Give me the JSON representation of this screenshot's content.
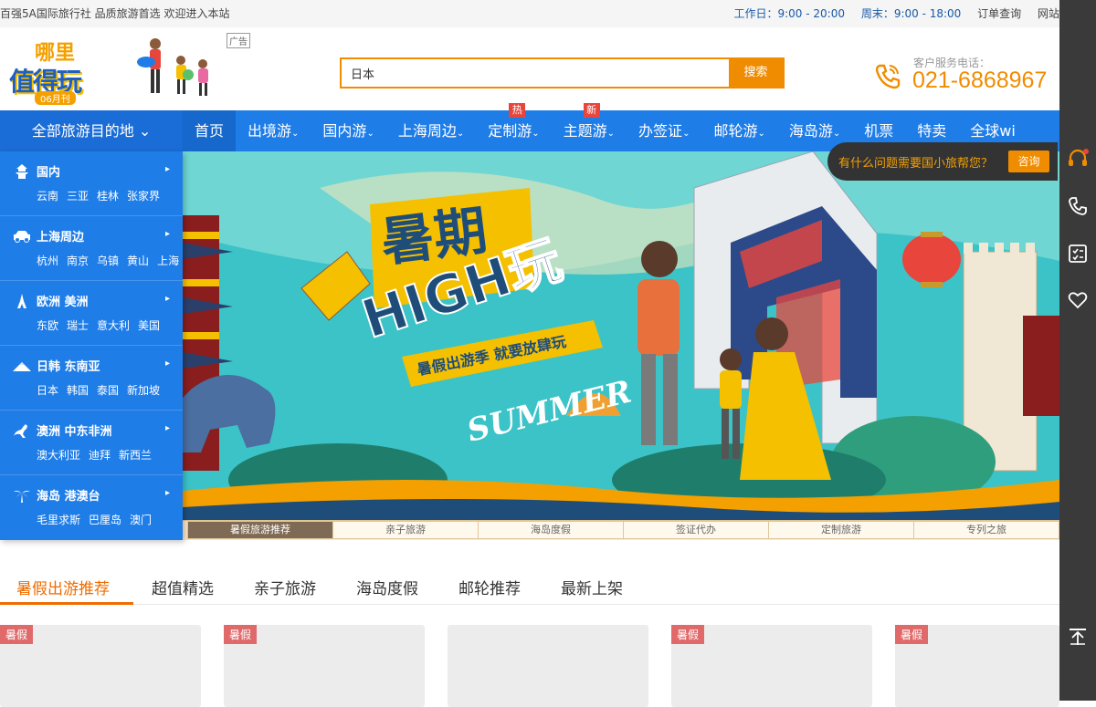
{
  "topbar": {
    "left_text": "百强5A国际旅行社 品质旅游首选   欢迎进入本站",
    "workday": "工作日：9:00 - 20:00",
    "weekend": "周末：9:00 - 18:00",
    "order": "订单查询",
    "site": "网站"
  },
  "header": {
    "logo_line1": "哪里",
    "logo_line2": "值得玩",
    "logo_badge": "06月刊",
    "ad_tag": "广告",
    "search_value": "日本",
    "search_button": "搜索",
    "phone_label": "客户服务电话：",
    "phone_number": "021-6868967"
  },
  "nav": {
    "all_destinations": "全部旅游目的地 ⌄",
    "items": [
      {
        "label": "首页"
      },
      {
        "label": "出境游"
      },
      {
        "label": "国内游"
      },
      {
        "label": "上海周边"
      },
      {
        "label": "定制游",
        "badge": "热"
      },
      {
        "label": "主题游",
        "badge": "新"
      },
      {
        "label": "办签证"
      },
      {
        "label": "邮轮游"
      },
      {
        "label": "海岛游"
      },
      {
        "label": "机票"
      },
      {
        "label": "特卖"
      },
      {
        "label": "全球wi"
      }
    ]
  },
  "sidemenu": [
    {
      "title": "国内",
      "icon": "pagoda-icon",
      "links": [
        "云南",
        "三亚",
        "桂林",
        "张家界"
      ]
    },
    {
      "title": "上海周边",
      "icon": "car-icon",
      "links": [
        "杭州",
        "南京",
        "乌镇",
        "黄山",
        "上海"
      ]
    },
    {
      "title": "欧洲  美洲",
      "icon": "eiffel-tower-icon",
      "links": [
        "东欧",
        "瑞士",
        "意大利",
        "美国"
      ]
    },
    {
      "title": "日韩  东南亚",
      "icon": "mountain-icon",
      "links": [
        "日本",
        "韩国",
        "泰国",
        "新加坡"
      ]
    },
    {
      "title": "澳洲  中东非洲",
      "icon": "kangaroo-icon",
      "links": [
        "澳大利亚",
        "迪拜",
        "新西兰"
      ]
    },
    {
      "title": "海岛  港澳台",
      "icon": "palm-tree-icon",
      "links": [
        "毛里求斯",
        "巴厘岛",
        "澳门"
      ]
    }
  ],
  "banner": {
    "headline1": "暑期",
    "headline2": "HIGH玩",
    "subline": "暑假出游季 就要放肆玩",
    "summer": "SUMMER"
  },
  "banner_tabs": [
    "暑假旅游推荐",
    "亲子旅游",
    "海岛度假",
    "签证代办",
    "定制旅游",
    "专列之旅"
  ],
  "consult": {
    "text": "有什么问题需要国小旅帮您？",
    "button": "咨询"
  },
  "category_tabs": [
    "暑假出游推荐",
    "超值精选",
    "亲子旅游",
    "海岛度假",
    "邮轮推荐",
    "最新上架"
  ],
  "cards": [
    {
      "tag": "暑假"
    },
    {
      "tag": "暑假"
    },
    {
      "tag": ""
    },
    {
      "tag": "暑假"
    },
    {
      "tag": "暑假"
    }
  ],
  "colors": {
    "nav_blue": "#1f7de8",
    "accent_orange": "#f08c00",
    "tab_orange": "#f06c00"
  }
}
